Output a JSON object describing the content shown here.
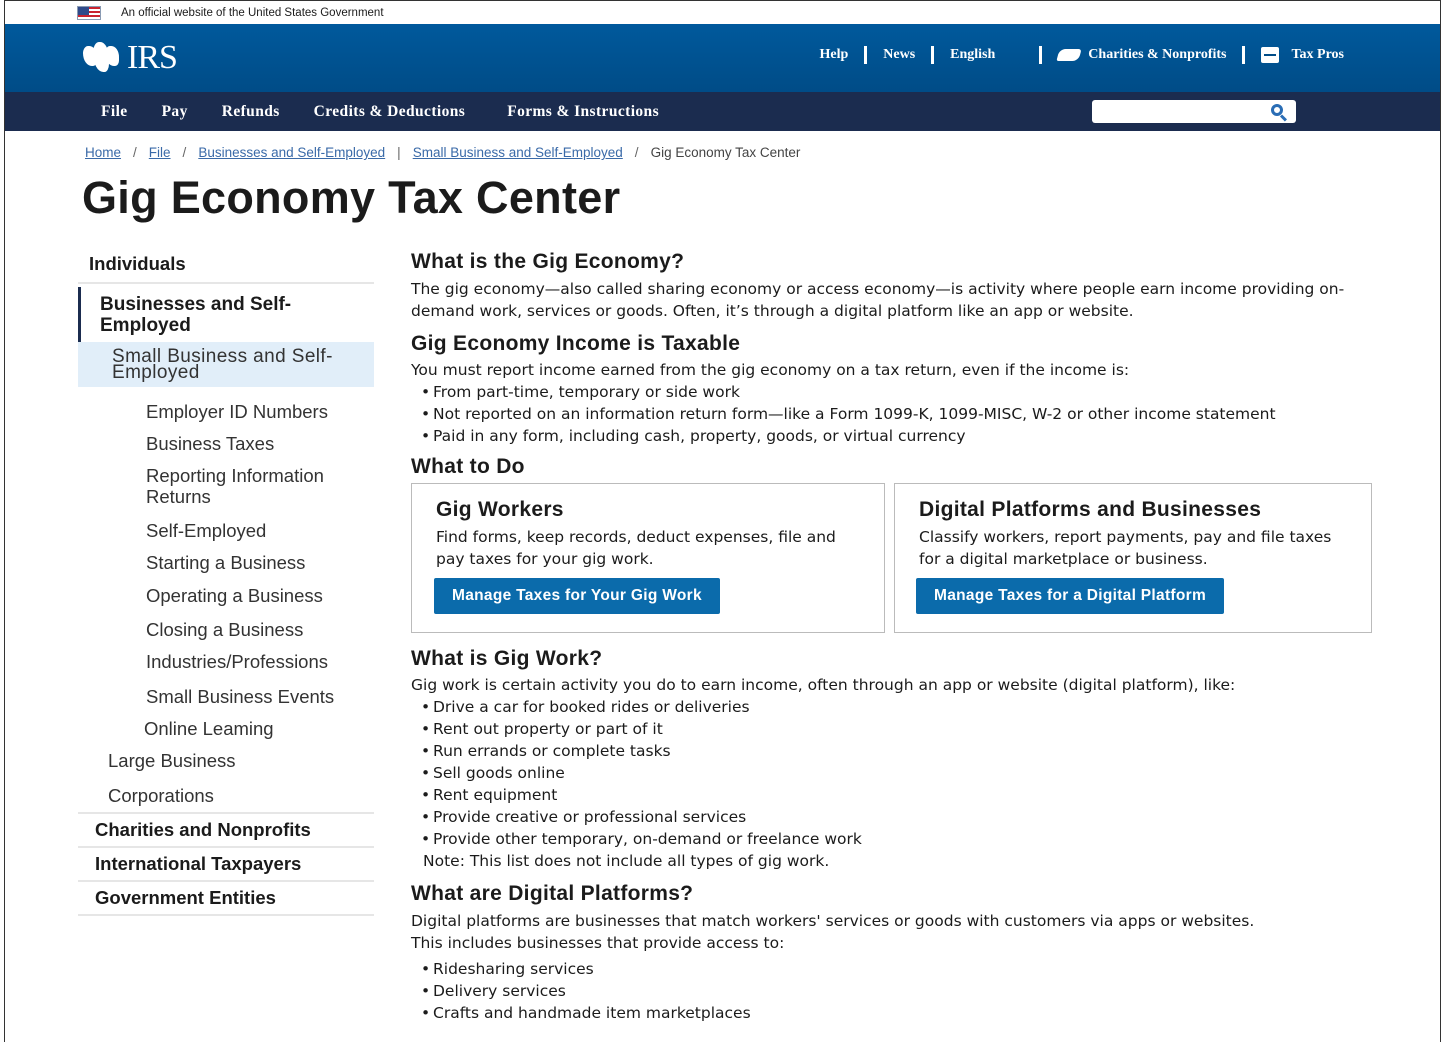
{
  "gov_banner": {
    "text": "An official website of the United States Government"
  },
  "header": {
    "logo_text": "IRS",
    "utility_nav": [
      "Help",
      "News",
      "English",
      "Charities & Nonprofits",
      "Tax Pros"
    ]
  },
  "main_nav": [
    "File",
    "Pay",
    "Refunds",
    "Credits & Deductions",
    "Forms & Instructions"
  ],
  "search": {
    "placeholder": ""
  },
  "breadcrumb": [
    "Home",
    "File",
    "Businesses and Self-Employed",
    "Small Business and Self-Employed",
    "Gig Economy Tax Center"
  ],
  "page_title": "Gig Economy Tax Center",
  "sidebar": {
    "top": "Individuals",
    "active": "Businesses and Self-Employed",
    "current": "Small Business and Self-Employed",
    "sub_items": [
      "Employer ID Numbers",
      "Business Taxes",
      "Reporting Information Returns",
      "Self-Employed",
      "Starting a Business",
      "Operating a Business",
      "Closing a Business",
      "Industries/Professions",
      "Small Business Events",
      "Online Leaming"
    ],
    "level2_items": [
      "Large Business",
      "Corporations"
    ],
    "bottom_items": [
      "Charities and Nonprofits",
      "International Taxpayers",
      "Government Entities"
    ]
  },
  "content": {
    "s1_title": "What is the Gig Economy?",
    "s1_body": "The gig economy—also called sharing economy or access economy—is activity where people earn income providing on-demand work, services or goods. Often, it’s through a digital platform like an app or website.",
    "s2_title": "Gig Economy Income is Taxable",
    "s2_body": "You must report income earned from the gig economy on a tax return, even if the income is:",
    "s2_list": [
      "From part-time, temporary or side work",
      "Not reported on an information return form—like a Form 1099-K, 1099-MISC, W-2 or other income statement",
      "Paid in any form, including cash, property, goods, or virtual currency"
    ],
    "s3_title": "What to Do",
    "card1": {
      "title": "Gig Workers",
      "body": "Find forms, keep records, deduct expenses, file and pay taxes for your gig work.",
      "button": "Manage Taxes for Your Gig Work"
    },
    "card2": {
      "title": "Digital Platforms and Businesses",
      "body": "Classify workers, report payments, pay and file taxes for a digital marketplace or business.",
      "button": "Manage Taxes for a Digital Platform"
    },
    "s4_title": "What is Gig Work?",
    "s4_body": "Gig work is certain activity you do to earn income, often through an app or website (digital platform), like:",
    "s4_list": [
      "Drive a car for booked rides or deliveries",
      "Rent out property or part of it",
      "Run errands or complete tasks",
      "Sell goods online",
      "Rent equipment",
      "Provide creative or professional services",
      "Provide other temporary, on-demand or freelance work"
    ],
    "s4_note": "Note: This list does not include all types of gig work.",
    "s5_title": "What are Digital Platforms?",
    "s5_body": "Digital platforms are businesses that match workers' services or goods with customers via apps or websites. This includes businesses that provide access to:",
    "s5_list": [
      "Ridesharing services",
      "Delivery services",
      "Crafts and handmade item marketplaces"
    ]
  }
}
